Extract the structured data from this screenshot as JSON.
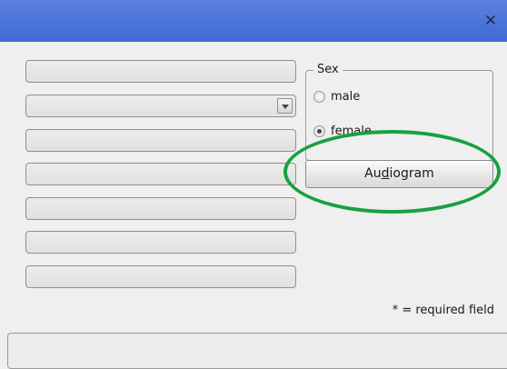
{
  "titlebar": {
    "close_icon": "close-icon"
  },
  "form": {
    "fields": [
      {
        "value": ""
      },
      {
        "value": "",
        "type": "combo"
      },
      {
        "value": ""
      },
      {
        "value": ""
      },
      {
        "value": ""
      },
      {
        "value": ""
      },
      {
        "value": ""
      }
    ]
  },
  "sex_group": {
    "legend": "Sex",
    "options": [
      {
        "label": "male",
        "checked": false
      },
      {
        "label": "female",
        "checked": true
      }
    ]
  },
  "audiogram_button": {
    "pre": "Au",
    "mnemonic": "d",
    "post": "iogram"
  },
  "footer": {
    "required_note": "* = required field"
  },
  "annotation": {
    "color": "#17a142"
  }
}
